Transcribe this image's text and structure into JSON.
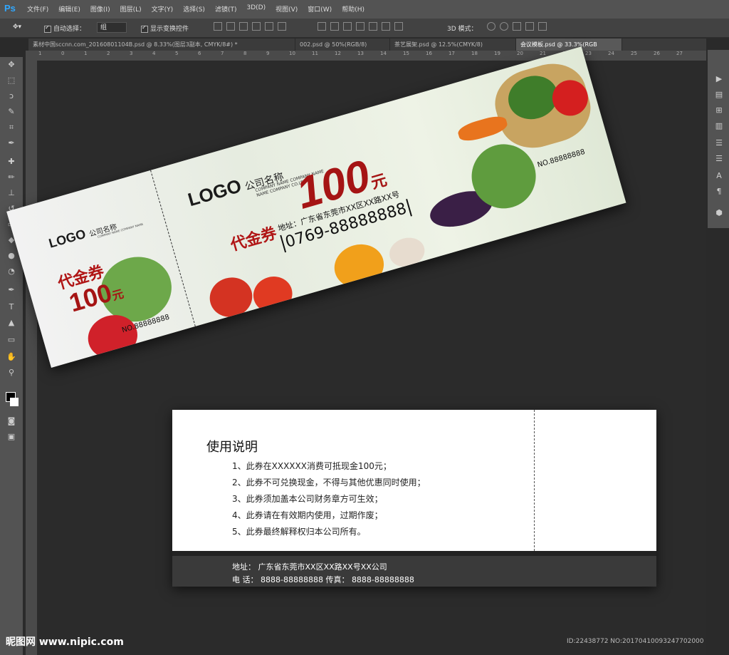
{
  "app": {
    "logo": "Ps"
  },
  "menu": [
    "文件(F)",
    "编辑(E)",
    "图像(I)",
    "图层(L)",
    "文字(Y)",
    "选择(S)",
    "滤镜(T)",
    "3D(D)",
    "视图(V)",
    "窗口(W)",
    "帮助(H)"
  ],
  "options": {
    "auto_select": "自动选择：",
    "select_value": "组",
    "show_transform": "显示变换控件",
    "mode_3d": "3D 模式："
  },
  "tabs": [
    "素材中国sccnn.com_20160801104B.psd @ 8.33%(图层3副本, CMYK/8#) *",
    "002.psd @ 50%(RGB/8)",
    "茶艺展架.psd @ 12.5%(CMYK/8)",
    "会议模板.psd @ 33.3%(RGB"
  ],
  "ruler_top": [
    "1",
    "0",
    "1",
    "2",
    "3",
    "4",
    "5",
    "6",
    "7",
    "8",
    "9",
    "10",
    "11",
    "12",
    "13",
    "14",
    "15",
    "16",
    "17",
    "18",
    "19",
    "20",
    "21",
    "22",
    "23",
    "24",
    "25",
    "26",
    "27"
  ],
  "front": {
    "stub": {
      "logo": "LOGO",
      "company": "公司名称",
      "company_en": "COMPANY NAME COMPANY NAME",
      "title": "代金券",
      "amount": "100",
      "unit": "元",
      "no": "NO.88888888"
    },
    "main": {
      "logo": "LOGO",
      "company": "公司名称",
      "company_en1": "COMPANY NAME COMPANY NAME",
      "company_en2": "NAME COMPANY CO.LTD",
      "title": "代金券",
      "amount": "100",
      "unit": "元",
      "address": "地址：广东省东莞市XX区XX路XX号",
      "phone": "0769-88888888",
      "no": "NO.88888888"
    }
  },
  "back": {
    "heading": "使用说明",
    "rules": [
      "1、此券在XXXXXX消费可抵现金100元；",
      "2、此券不可兑换现金，不得与其他优惠同时使用；",
      "3、此券须加盖本公司财务章方可生效；",
      "4、此券请在有效期内使用，过期作废；",
      "5、此券最终解释权归本公司所有。"
    ],
    "address": "地址：  广东省东莞市XX区XX路XX号XX公司",
    "contact": "电 话：  8888-88888888  传真： 8888-88888888"
  },
  "watermark": "昵图网 www.nipic.com",
  "image_id": "ID:22438772 NO:20170410093247702000",
  "colors": {
    "accent_red": "#b01515",
    "ui_dark": "#535353",
    "canvas": "#2b2b2b"
  }
}
